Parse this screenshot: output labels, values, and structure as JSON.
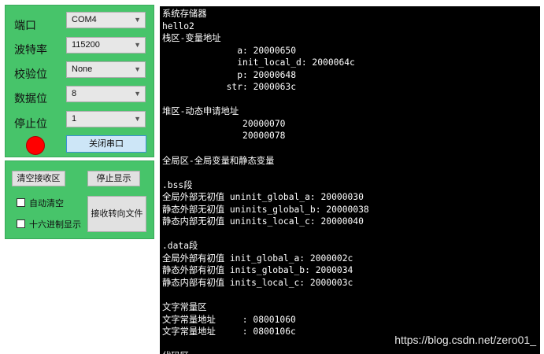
{
  "settings": {
    "port": {
      "label": "端口",
      "value": "COM4"
    },
    "baud": {
      "label": "波特率",
      "value": "115200"
    },
    "parity": {
      "label": "校验位",
      "value": "None"
    },
    "databits": {
      "label": "数据位",
      "value": "8"
    },
    "stopbits": {
      "label": "停止位",
      "value": "1"
    },
    "dropdown_icon": "chevron-down-icon",
    "status_color": "#ff0000",
    "close_port_label": "关闭串口"
  },
  "controls": {
    "clear_label": "清空接收区",
    "stop_display_label": "停止显示",
    "auto_clear_label": "自动清空",
    "auto_clear_checked": false,
    "hex_display_label": "十六进制显示",
    "hex_display_checked": false,
    "save_to_file_line1": "接收转向文件"
  },
  "console": {
    "lines": [
      "系统存储器",
      "hello2",
      "栈区-变量地址",
      "              a: 20000650",
      "              init_local_d: 2000064c",
      "              p: 20000648",
      "            str: 2000063c",
      "",
      "堆区-动态申请地址",
      "               20000070",
      "               20000078",
      "",
      "全局区-全局变量和静态变量",
      "",
      ".bss段",
      "全局外部无初值 uninit_global_a: 20000030",
      "静态外部无初值 uninits_global_b: 20000038",
      "静态内部无初值 uninits_local_c: 20000040",
      "",
      ".data段",
      "全局外部有初值 init_global_a: 2000002c",
      "静态外部有初值 inits_global_b: 2000034",
      "静态内部有初值 inits_local_c: 2000003c",
      "",
      "文字常量区",
      "文字常量地址     : 08001060",
      "文字常量地址     : 0800106c",
      "",
      "代码区"
    ]
  },
  "watermark": "https://blog.csdn.net/zero01_"
}
